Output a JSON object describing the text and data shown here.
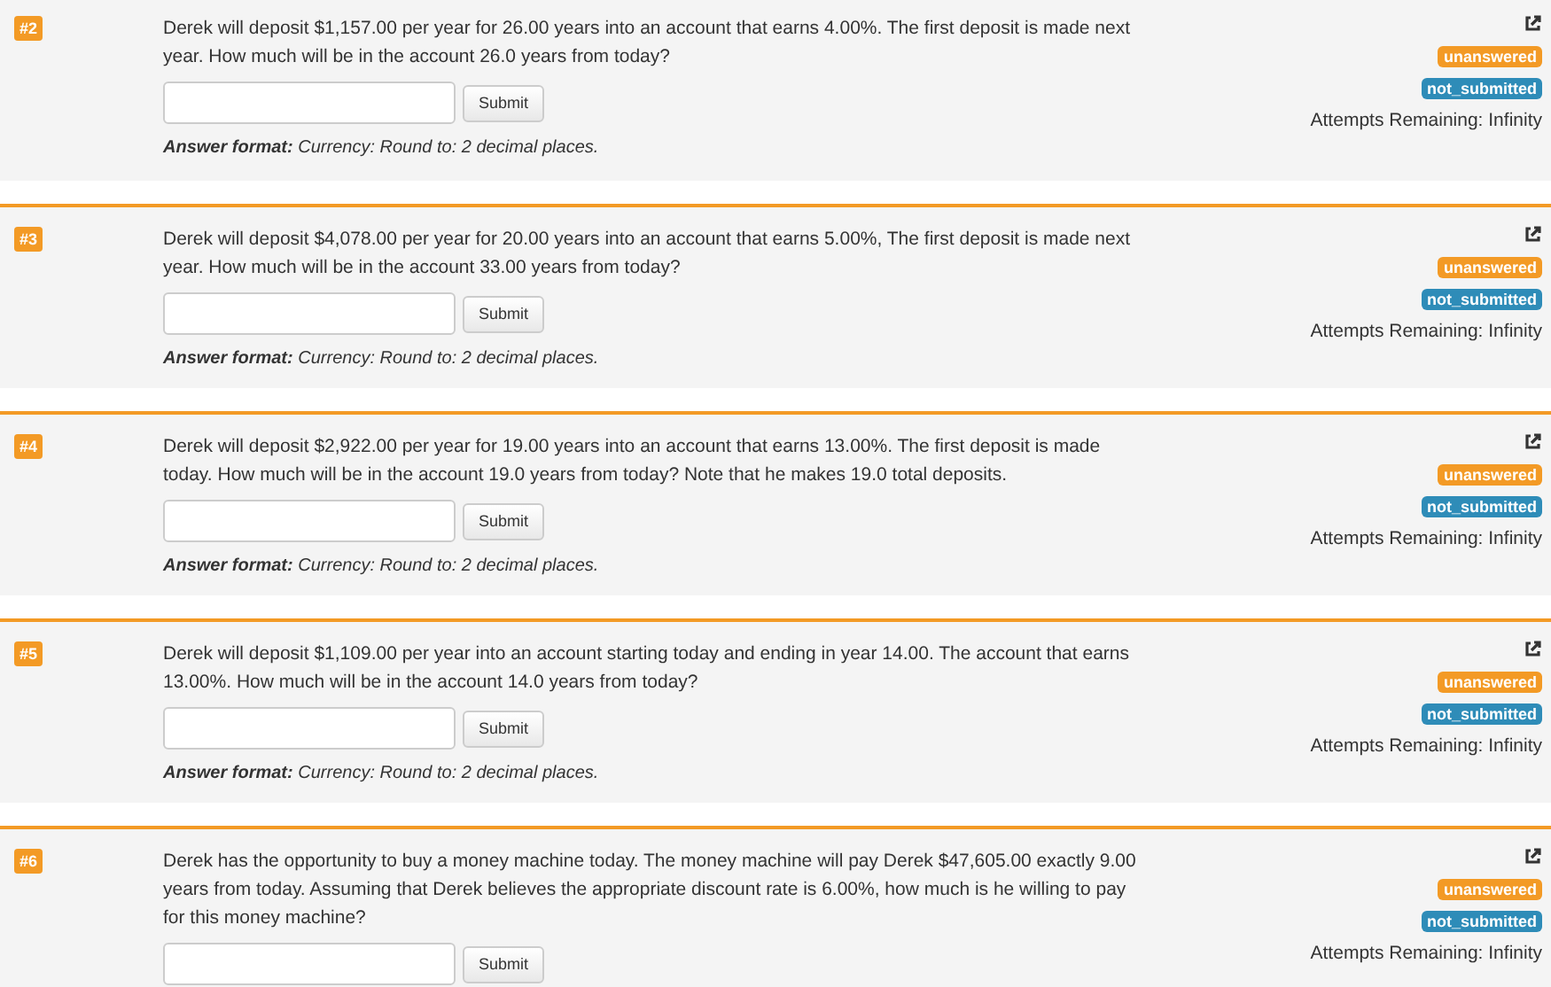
{
  "questions": [
    {
      "number": "#2",
      "text": "Derek will deposit $1,157.00 per year for 26.00 years into an account that earns 4.00%. The first deposit is made next year. How much will be in the account 26.0 years from today?",
      "submit": "Submit",
      "answer_format": "**Answer format:** Currency: Round to: 2 decimal places.",
      "status": "unanswered",
      "submission": "not_submitted",
      "attempts": "Attempts Remaining: Infinity"
    },
    {
      "number": "#3",
      "text": "Derek will deposit $4,078.00 per year for 20.00 years into an account that earns 5.00%, The first deposit is made next year. How much will be in the account 33.00 years from today?",
      "submit": "Submit",
      "answer_format": "**Answer format:** Currency: Round to: 2 decimal places.",
      "status": "unanswered",
      "submission": "not_submitted",
      "attempts": "Attempts Remaining: Infinity"
    },
    {
      "number": "#4",
      "text": "Derek will deposit $2,922.00 per year for 19.00 years into an account that earns 13.00%. The first deposit is made today. How much will be in the account 19.0 years from today? Note that he makes 19.0 total deposits.",
      "submit": "Submit",
      "answer_format": "**Answer format:** Currency: Round to: 2 decimal places.",
      "status": "unanswered",
      "submission": "not_submitted",
      "attempts": "Attempts Remaining: Infinity"
    },
    {
      "number": "#5",
      "text": "Derek will deposit $1,109.00 per year into an account starting today and ending in year 14.00. The account that earns 13.00%. How much will be in the account 14.0 years from today?",
      "submit": "Submit",
      "answer_format": "**Answer format:** Currency: Round to: 2 decimal places.",
      "status": "unanswered",
      "submission": "not_submitted",
      "attempts": "Attempts Remaining: Infinity"
    },
    {
      "number": "#6",
      "text": "Derek has the opportunity to buy a money machine today. The money machine will pay Derek $47,605.00 exactly 9.00 years from today. Assuming that Derek believes the appropriate discount rate is 6.00%, how much is he willing to pay for this money machine?",
      "submit": "Submit",
      "status": "unanswered",
      "submission": "not_submitted",
      "attempts": "Attempts Remaining: Infinity"
    }
  ]
}
